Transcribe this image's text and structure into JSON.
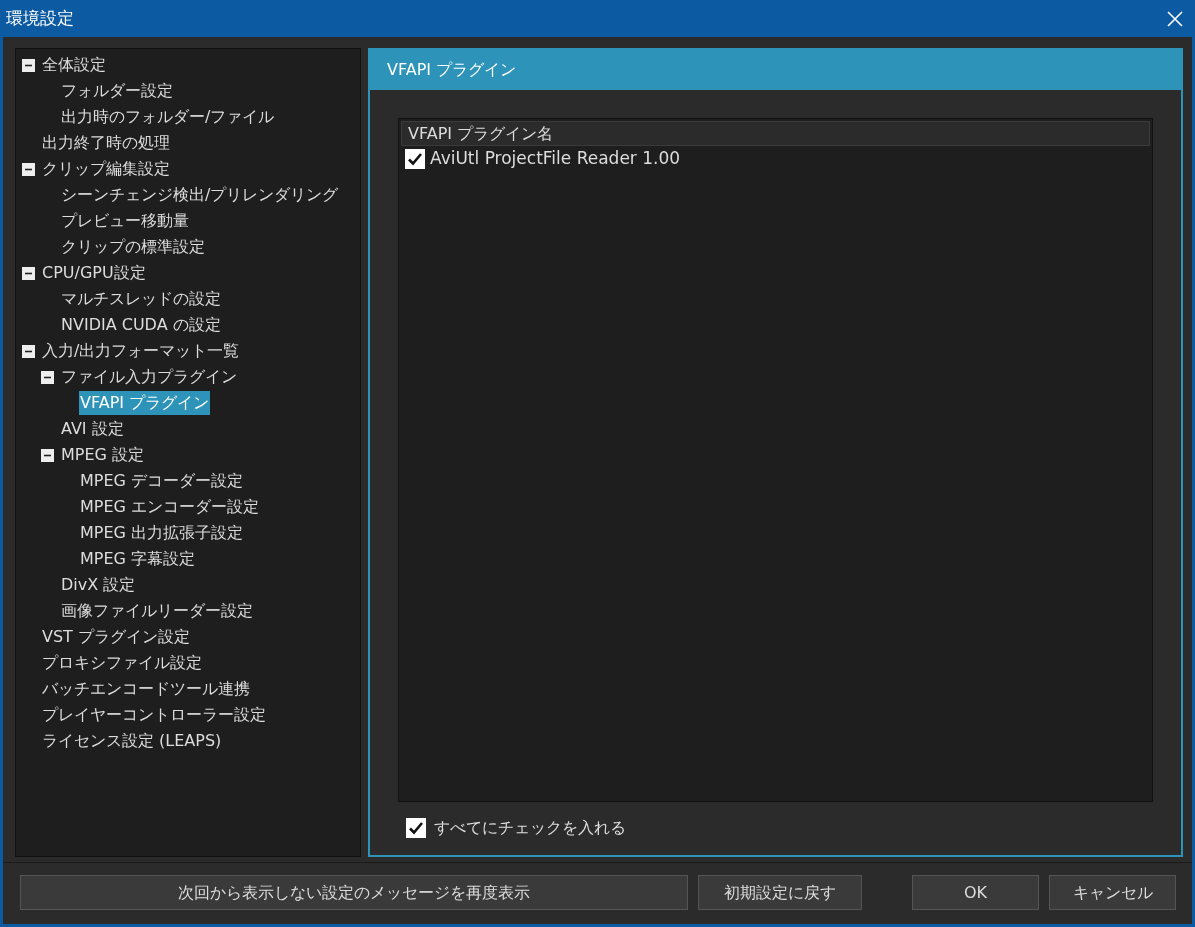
{
  "window": {
    "title": "環境設定"
  },
  "tree": [
    {
      "label": "全体設定",
      "expanded": true,
      "selected": false,
      "children": [
        {
          "label": "フォルダー設定",
          "selected": false
        },
        {
          "label": "出力時のフォルダー/ファイル",
          "selected": false
        }
      ]
    },
    {
      "label": "出力終了時の処理",
      "selected": false
    },
    {
      "label": "クリップ編集設定",
      "expanded": true,
      "selected": false,
      "children": [
        {
          "label": "シーンチェンジ検出/プリレンダリング",
          "selected": false
        },
        {
          "label": "プレビュー移動量",
          "selected": false
        },
        {
          "label": "クリップの標準設定",
          "selected": false
        }
      ]
    },
    {
      "label": "CPU/GPU設定",
      "expanded": true,
      "selected": false,
      "children": [
        {
          "label": "マルチスレッドの設定",
          "selected": false
        },
        {
          "label": "NVIDIA CUDA の設定",
          "selected": false
        }
      ]
    },
    {
      "label": "入力/出力フォーマット一覧",
      "expanded": true,
      "selected": false,
      "children": [
        {
          "label": "ファイル入力プラグイン",
          "expanded": true,
          "selected": false,
          "children": [
            {
              "label": "VFAPI プラグイン",
              "selected": true
            }
          ]
        },
        {
          "label": "AVI 設定",
          "selected": false
        },
        {
          "label": "MPEG 設定",
          "expanded": true,
          "selected": false,
          "children": [
            {
              "label": "MPEG デコーダー設定",
              "selected": false
            },
            {
              "label": "MPEG エンコーダー設定",
              "selected": false
            },
            {
              "label": "MPEG 出力拡張子設定",
              "selected": false
            },
            {
              "label": "MPEG 字幕設定",
              "selected": false
            }
          ]
        },
        {
          "label": "DivX 設定",
          "selected": false
        },
        {
          "label": "画像ファイルリーダー設定",
          "selected": false
        }
      ]
    },
    {
      "label": "VST プラグイン設定",
      "selected": false
    },
    {
      "label": "プロキシファイル設定",
      "selected": false
    },
    {
      "label": "バッチエンコードツール連携",
      "selected": false
    },
    {
      "label": "プレイヤーコントローラー設定",
      "selected": false
    },
    {
      "label": "ライセンス設定 (LEAPS)",
      "selected": false
    }
  ],
  "panel": {
    "title": "VFAPI プラグイン",
    "list": {
      "column": "VFAPI プラグイン名",
      "rows": [
        {
          "label": "AviUtl ProjectFile Reader 1.00",
          "checked": true
        }
      ]
    },
    "check_all": {
      "label": "すべてにチェックを入れる",
      "checked": true
    }
  },
  "buttons": [
    {
      "label": "次回から表示しない設定のメッセージを再度表示"
    },
    {
      "label": "初期設定に戻す"
    },
    {
      "label": "OK"
    },
    {
      "label": "キャンセル"
    }
  ]
}
